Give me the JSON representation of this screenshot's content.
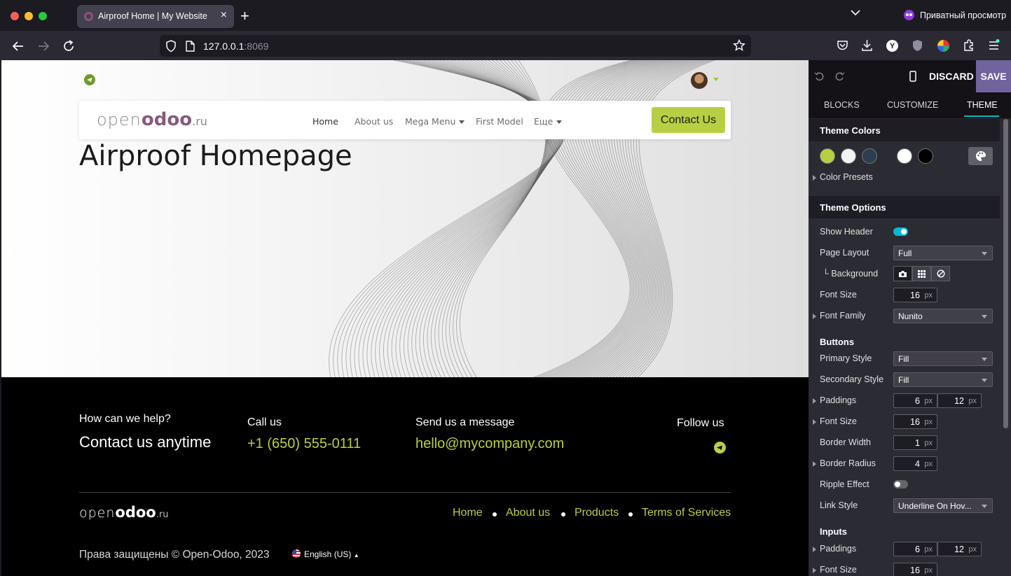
{
  "browser": {
    "tab_title": "Airproof Home | My Website",
    "private_label": "Приватный просмотр",
    "url_host": "127.0.0.1",
    "url_port": ":8069"
  },
  "site": {
    "logo_open": "open",
    "logo_odoo": "odoo",
    "logo_ru": ".ru",
    "menu": [
      "Home",
      "About us",
      "Mega Menu",
      "First Model",
      "Еще"
    ],
    "contact_button": "Contact Us",
    "hero_title": "Airproof Homepage",
    "footer": {
      "help_small": "How can we help?",
      "help_big": "Contact us anytime",
      "call_small": "Call us",
      "call_big": "+1 (650) 555-0111",
      "message_small": "Send us a message",
      "message_big": "hello@mycompany.com",
      "follow": "Follow us",
      "links": [
        "Home",
        "About us",
        "Products",
        "Terms of Services"
      ],
      "copyright": "Права защищены © Open-Odoo, 2023",
      "language": "English (US)"
    },
    "accent_color": "#b7cf45"
  },
  "editor": {
    "discard": "DISCARD",
    "save": "SAVE",
    "tabs": [
      "BLOCKS",
      "CUSTOMIZE",
      "THEME"
    ],
    "active_tab": "THEME",
    "theme_colors_title": "Theme Colors",
    "theme_colors": [
      "#b7cf45",
      "#f3f3f3",
      "#2d3e50",
      "#ffffff",
      "#000000"
    ],
    "color_presets": "Color Presets",
    "theme_options_title": "Theme Options",
    "show_header": "Show Header",
    "show_header_on": true,
    "page_layout": "Page Layout",
    "page_layout_value": "Full",
    "background": "└ Background",
    "font_size": "Font Size",
    "font_size_value": "16",
    "unit": "px",
    "font_family": "Font Family",
    "font_family_value": "Nunito",
    "buttons_title": "Buttons",
    "primary_style": "Primary Style",
    "primary_style_value": "Fill",
    "secondary_style": "Secondary Style",
    "secondary_style_value": "Fill",
    "paddings": "Paddings",
    "btn_padding_y": "6",
    "btn_padding_x": "12",
    "btn_font_size": "16",
    "border_width": "Border Width",
    "border_width_value": "1",
    "border_radius": "Border Radius",
    "border_radius_value": "4",
    "ripple_effect": "Ripple Effect",
    "ripple_on": false,
    "link_style": "Link Style",
    "link_style_value": "Underline On Hov...",
    "inputs_title": "Inputs",
    "input_padding_y": "6",
    "input_padding_x": "12",
    "input_font_size": "16"
  }
}
